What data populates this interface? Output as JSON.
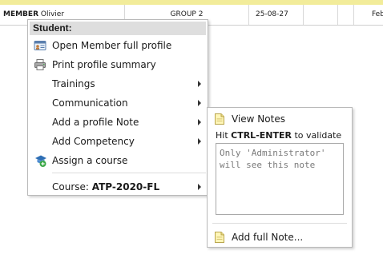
{
  "table": {
    "row": {
      "member_last": "MEMBER",
      "member_first": "Olivier",
      "group": "GROUP 2",
      "date": "25-08-27",
      "col4": "",
      "col5": "",
      "month": "Feb"
    }
  },
  "context_menu": {
    "header": "Student:",
    "items": [
      {
        "label": "Open Member full profile",
        "icon": "id-card-icon"
      },
      {
        "label": "Print profile summary",
        "icon": "printer-icon"
      },
      {
        "label": "Trainings",
        "submenu": true
      },
      {
        "label": "Communication",
        "submenu": true
      },
      {
        "label": "Add a profile Note",
        "submenu": true
      },
      {
        "label": "Add Competency",
        "submenu": true
      },
      {
        "label": "Assign a course",
        "icon": "assign-course-icon"
      }
    ],
    "course": {
      "label": "Course:",
      "value": "ATP-2020-FL",
      "submenu": true
    }
  },
  "notes_submenu": {
    "view_notes": "View Notes",
    "hint_prefix": "Hit",
    "hint_key": "CTRL-ENTER",
    "hint_suffix": "to validate",
    "note_placeholder": "Only 'Administrator' will see this note",
    "add_full_note": "Add full Note..."
  },
  "colors": {
    "top_strip": "#f2ec9a",
    "menu_header_bg": "#dedede",
    "menu_border": "#b9b9b9"
  }
}
